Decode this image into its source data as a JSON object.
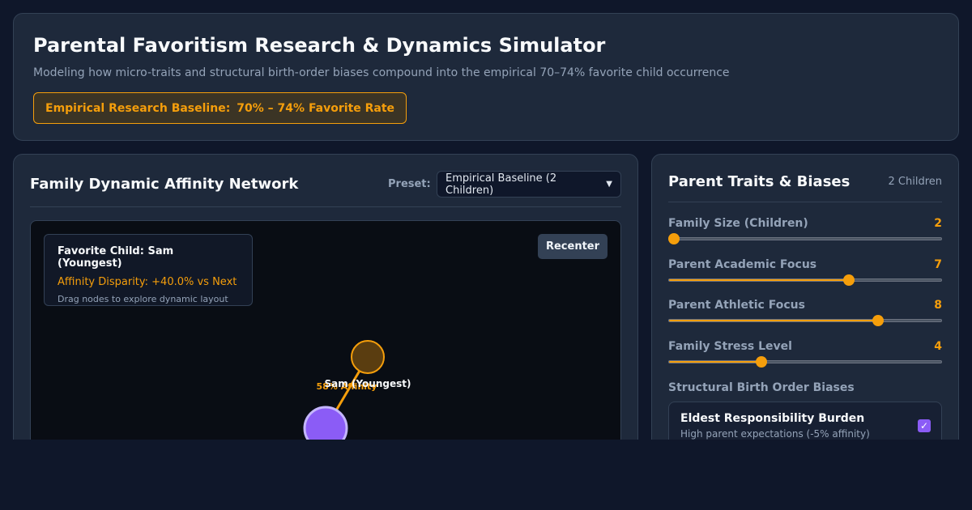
{
  "header": {
    "title": "Parental Favoritism Research & Dynamics Simulator",
    "subtitle": "Modeling how micro-traits and structural birth-order biases compound into the empirical 70–74% favorite child occurrence",
    "baseline_label": "Empirical Research Baseline:",
    "baseline_value": "70% – 74% Favorite Rate"
  },
  "network": {
    "title": "Family Dynamic Affinity Network",
    "preset_label": "Preset:",
    "preset_value": "Empirical Baseline (2 Children)",
    "favorite_text": "Favorite Child: Sam (Youngest)",
    "disparity_text": "Affinity Disparity: +40.0% vs Next",
    "drag_hint": "Drag nodes to explore dynamic layout",
    "recenter_label": "Recenter",
    "node_label": "Sam (Youngest)",
    "edge_label": "58% Affinity"
  },
  "sidebar": {
    "title": "Parent Traits & Biases",
    "children_count": "2 Children",
    "sliders": [
      {
        "label": "Family Size (Children)",
        "value": "2",
        "level": 0.0
      },
      {
        "label": "Parent Academic Focus",
        "value": "7",
        "level": 0.667
      },
      {
        "label": "Parent Athletic Focus",
        "value": "8",
        "level": 0.778
      },
      {
        "label": "Family Stress Level",
        "value": "4",
        "level": 0.333
      }
    ],
    "section_label": "Structural Birth Order Biases",
    "bias": {
      "title": "Eldest Responsibility Burden",
      "description": "High parent expectations (-5% affinity)",
      "checked": true
    }
  },
  "colors": {
    "accent": "#f59e0b",
    "purple": "#8b5cf6",
    "background": "#0f172a",
    "card": "#1e293b"
  }
}
